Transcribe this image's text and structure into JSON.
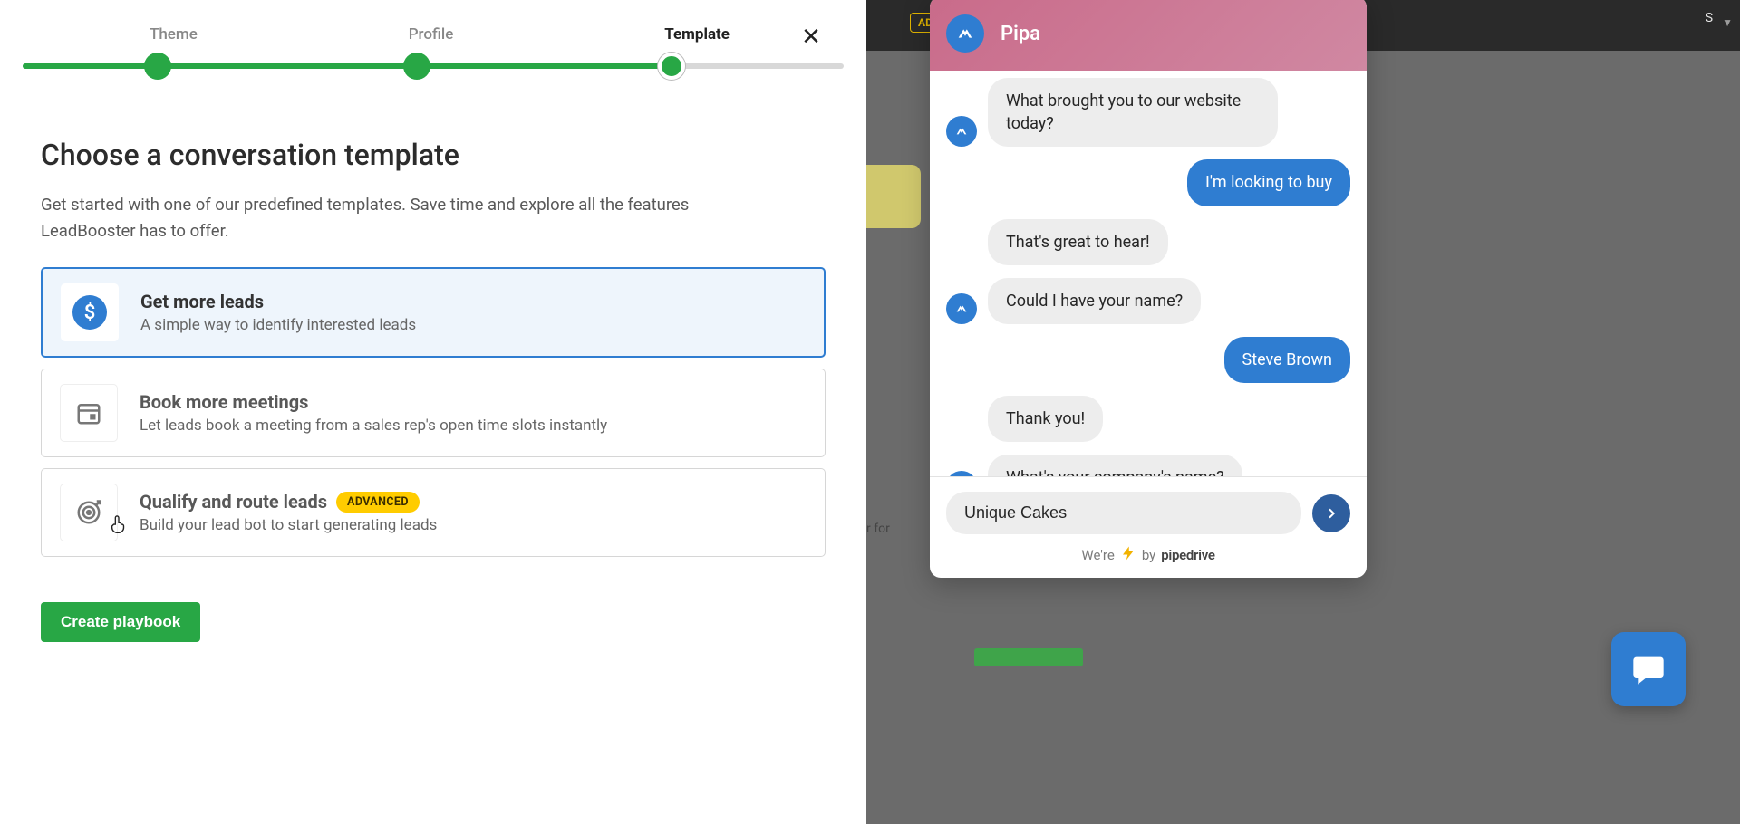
{
  "stepper": {
    "steps": [
      "Theme",
      "Profile",
      "Template"
    ],
    "active_index": 2
  },
  "page": {
    "title": "Choose a conversation template",
    "description": "Get started with one of our predefined templates. Save time and explore all the features LeadBooster has to offer."
  },
  "templates": [
    {
      "key": "get-more-leads",
      "title": "Get more leads",
      "desc": "A simple way to identify interested leads",
      "icon": "dollar",
      "selected": true,
      "badge": null
    },
    {
      "key": "book-more-meetings",
      "title": "Book more meetings",
      "desc": "Let leads book a meeting from a sales rep's open time slots instantly",
      "icon": "calendar",
      "selected": false,
      "badge": null
    },
    {
      "key": "qualify-route-leads",
      "title": "Qualify and route leads",
      "desc": "Build your lead bot to start generating leads",
      "icon": "target",
      "selected": false,
      "badge": "ADVANCED"
    }
  ],
  "actions": {
    "create_playbook": "Create playbook"
  },
  "backdrop": {
    "adv_label": "AD",
    "topright_s": "S",
    "r_for": "r for"
  },
  "chat": {
    "bot_name": "Pipa",
    "messages": [
      {
        "from": "bot",
        "text": "What brought you to our website today?",
        "show_avatar": true
      },
      {
        "from": "user",
        "text": "I'm looking to buy"
      },
      {
        "from": "bot",
        "text": "That's great to hear!",
        "show_avatar": false
      },
      {
        "from": "bot",
        "text": "Could I have your name?",
        "show_avatar": true
      },
      {
        "from": "user",
        "text": "Steve Brown"
      },
      {
        "from": "bot",
        "text": "Thank you!",
        "show_avatar": false
      },
      {
        "from": "bot",
        "text": "What's your company's name?",
        "show_avatar": true
      }
    ],
    "input_value": "Unique Cakes",
    "footer_prefix": "We're",
    "footer_by": "by",
    "footer_brand": "pipedrive"
  }
}
